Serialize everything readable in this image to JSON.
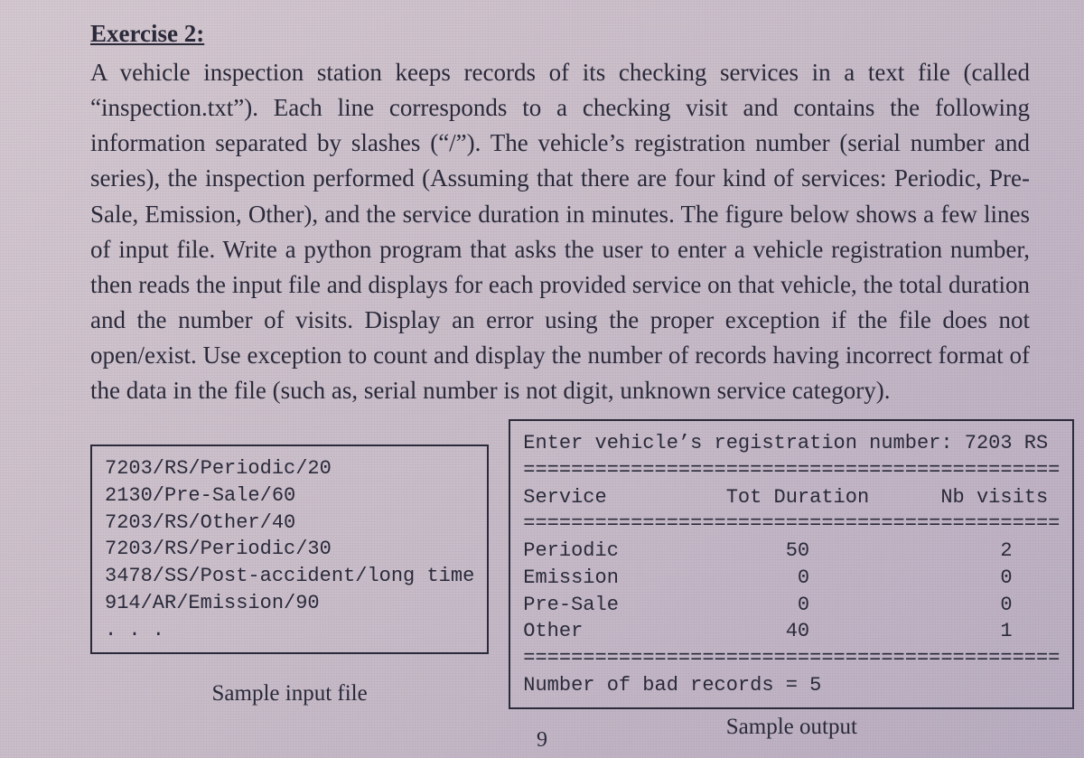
{
  "heading": "Exercise 2:",
  "problem": "A vehicle inspection station keeps records of its checking services in a text file (called “inspection.txt”). Each line corresponds to a checking visit and contains the following information separated by slashes (“/”). The vehicle’s registration number (serial number and series), the inspection performed (Assuming that there are four kind of services: Periodic, Pre-Sale, Emission, Other), and the service duration in minutes. The figure below shows a few lines of input file. Write a python program that asks the user to enter a vehicle registration number, then reads the input file and displays for each provided service on that vehicle, the total duration and the number of visits. Display an error using the proper exception if the file does not open/exist. Use exception to count and display the number of records having incorrect format of the data in the file (such as, serial number is not digit, unknown service category).",
  "input_file": "7203/RS/Periodic/20\n2130/Pre-Sale/60\n7203/RS/Other/40\n7203/RS/Periodic/30\n3478/SS/Post-accident/long time\n914/AR/Emission/90\n. . .",
  "input_caption": "Sample input file",
  "output": "Enter vehicle’s registration number: 7203 RS\n=============================================\nService          Tot Duration      Nb visits\n=============================================\nPeriodic              50                2\nEmission               0                0\nPre-Sale               0                0\nOther                 40                1\n=============================================\nNumber of bad records = 5",
  "output_caption": "Sample output",
  "page_number": "9"
}
